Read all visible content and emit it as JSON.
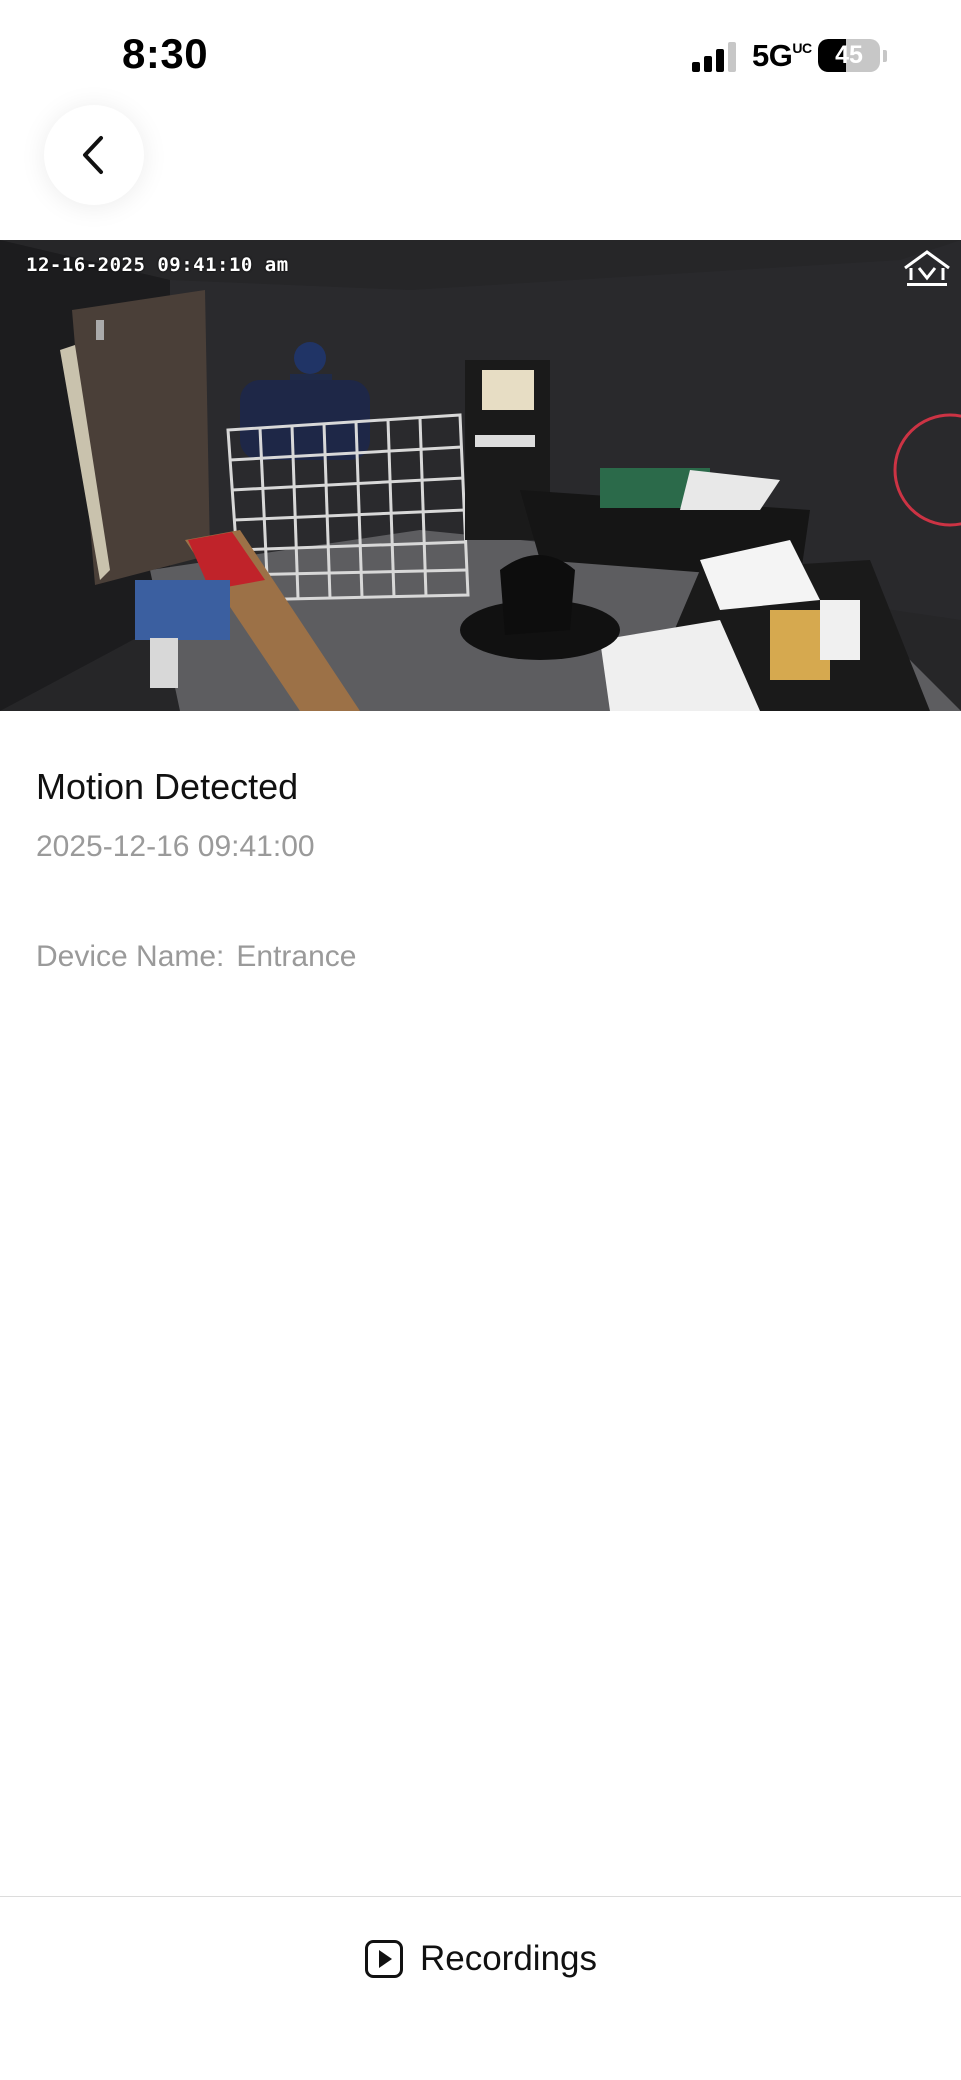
{
  "status_bar": {
    "time": "8:30",
    "network": "5G",
    "network_suffix": "UC",
    "battery": "45",
    "battery_level": 0.45
  },
  "header": {
    "back_icon": "chevron-left-icon"
  },
  "snapshot": {
    "overlay_timestamp": "12-16-2025 09:41:10 am"
  },
  "event": {
    "title": "Motion Detected",
    "time": "2025-12-16 09:41:00",
    "device_label": "Device Name:",
    "device_name": "Entrance"
  },
  "footer": {
    "recordings_label": "Recordings",
    "recordings_icon": "play-square-icon"
  },
  "colors": {
    "text_primary": "#111111",
    "text_secondary": "#9a9a9a",
    "divider": "#dcdcdc"
  }
}
